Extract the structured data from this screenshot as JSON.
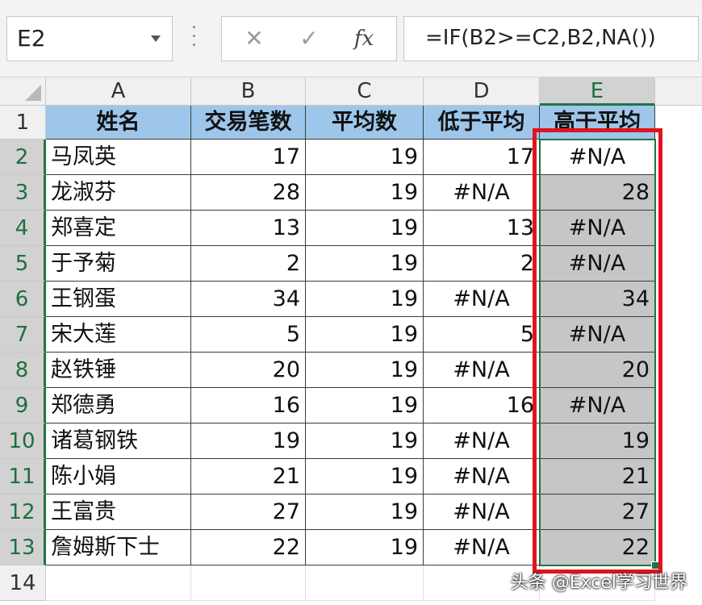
{
  "name_box": {
    "value": "E2",
    "dropdown_icon": "chevron-down-icon"
  },
  "formula_bar": {
    "cancel_icon": "close-icon",
    "cancel_glyph": "✕",
    "enter_icon": "check-icon",
    "enter_glyph": "✓",
    "fx_label": "fx",
    "formula": "=IF(B2>=C2,B2,NA())"
  },
  "columns": [
    "A",
    "B",
    "C",
    "D",
    "E"
  ],
  "selected_column": "E",
  "row_numbers": [
    "1",
    "2",
    "3",
    "4",
    "5",
    "6",
    "7",
    "8",
    "9",
    "10",
    "11",
    "12",
    "13",
    "14"
  ],
  "header_row": [
    "姓名",
    "交易笔数",
    "平均数",
    "低于平均",
    "高于平均"
  ],
  "rows": [
    [
      "马凤英",
      "17",
      "19",
      "17",
      "#N/A"
    ],
    [
      "龙淑芬",
      "28",
      "19",
      "#N/A",
      "28"
    ],
    [
      "郑喜定",
      "13",
      "19",
      "13",
      "#N/A"
    ],
    [
      "于予菊",
      "2",
      "19",
      "2",
      "#N/A"
    ],
    [
      "王钢蛋",
      "34",
      "19",
      "#N/A",
      "34"
    ],
    [
      "宋大莲",
      "5",
      "19",
      "5",
      "#N/A"
    ],
    [
      "赵铁锤",
      "20",
      "19",
      "#N/A",
      "20"
    ],
    [
      "郑德勇",
      "16",
      "19",
      "16",
      "#N/A"
    ],
    [
      "诸葛钢铁",
      "19",
      "19",
      "#N/A",
      "19"
    ],
    [
      "陈小娟",
      "21",
      "19",
      "#N/A",
      "21"
    ],
    [
      "王富贵",
      "27",
      "19",
      "#N/A",
      "27"
    ],
    [
      "詹姆斯下士",
      "22",
      "19",
      "#N/A",
      "22"
    ]
  ],
  "watermark": "头条 @Excel学习世界",
  "colors": {
    "header_fill": "#9ec6ea",
    "selection_fill": "#c6c6c6",
    "selection_border": "#217346",
    "highlight_box": "#e0141e"
  }
}
